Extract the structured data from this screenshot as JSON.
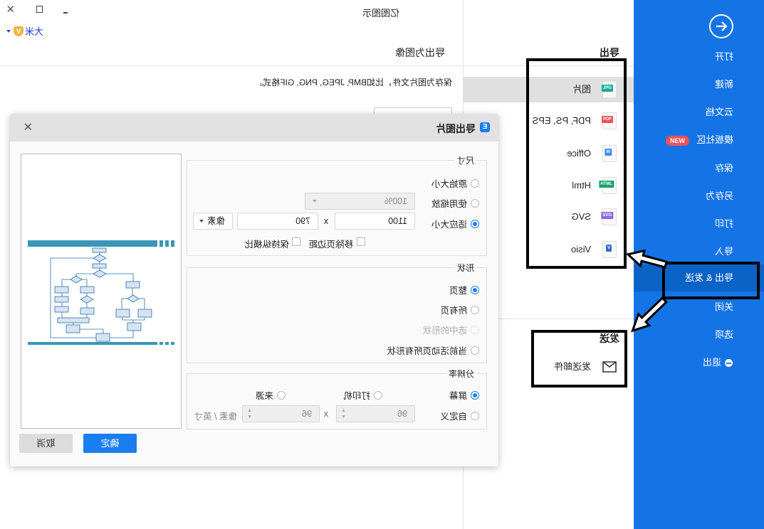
{
  "window": {
    "title": "亿图图示",
    "user": "大米",
    "controls": [
      "minimize",
      "maximize",
      "close"
    ]
  },
  "sidebar": {
    "items": [
      {
        "label": "打开"
      },
      {
        "label": "新建"
      },
      {
        "label": "云文档"
      },
      {
        "label": "模板社区",
        "badge": "NEW"
      },
      {
        "label": "保存"
      },
      {
        "label": "另存为"
      },
      {
        "label": "打印"
      },
      {
        "label": "导入"
      },
      {
        "label": "导出 & 发送",
        "active": true
      },
      {
        "label": "关闭"
      },
      {
        "label": "选项"
      },
      {
        "label": "退出"
      }
    ]
  },
  "export_panel": {
    "heading": "导出",
    "formats": [
      {
        "label": "图片",
        "icon": "jpg-file-icon",
        "tag": "JPG",
        "color": "#19a99a",
        "selected": true
      },
      {
        "label": "PDF, PS, EPS",
        "icon": "pdf-file-icon",
        "tag": "PDF",
        "color": "#f0515a"
      },
      {
        "label": "Office",
        "icon": "word-file-icon",
        "tag": "W",
        "color": "#3c8ef0"
      },
      {
        "label": "Html",
        "icon": "html-file-icon",
        "tag": "HTML",
        "color": "#1aa36a"
      },
      {
        "label": "SVG",
        "icon": "svg-file-icon",
        "tag": "SVG",
        "color": "#8b6be0"
      },
      {
        "label": "Visio",
        "icon": "visio-file-icon",
        "tag": "V",
        "color": "#2f6fd0"
      }
    ],
    "send_heading": "发送",
    "send_items": [
      {
        "label": "发送邮件",
        "icon": "email-icon"
      }
    ]
  },
  "content": {
    "title": "导出为图像",
    "description": "保存为图片文件，比如BMP, JPEG, PNG, GIF格式。"
  },
  "dialog": {
    "title": "导出图片",
    "size": {
      "legend": "尺寸",
      "original": "原始大小",
      "use_zoom": "使用缩放",
      "zoom_value": "100%",
      "fit": "适应大小",
      "width": "1100",
      "x": "x",
      "height": "790",
      "unit": "像素",
      "remove_margin": "移除页边距",
      "keep_ratio": "保持纵横比",
      "selected": "fit"
    },
    "shape": {
      "legend": "形状",
      "options": [
        "整页",
        "所有页",
        "选中的形状",
        "当前活动页所有形状"
      ],
      "selected": "整页",
      "disabled": [
        "选中的形状"
      ]
    },
    "resolution": {
      "legend": "分辨率",
      "screen": "屏幕",
      "printer": "打印机",
      "source": "来源",
      "custom": "自定义",
      "dpi_x": "96",
      "x": "x",
      "dpi_y": "96",
      "unit": "像素 / 英寸",
      "selected": "屏幕"
    },
    "ok": "确定",
    "cancel": "取消"
  },
  "colors": {
    "sidebar": "#1474e6",
    "sidebar_active": "#0b63c6",
    "primary_button": "#1a7ef0",
    "new_badge": "#f0515a"
  }
}
